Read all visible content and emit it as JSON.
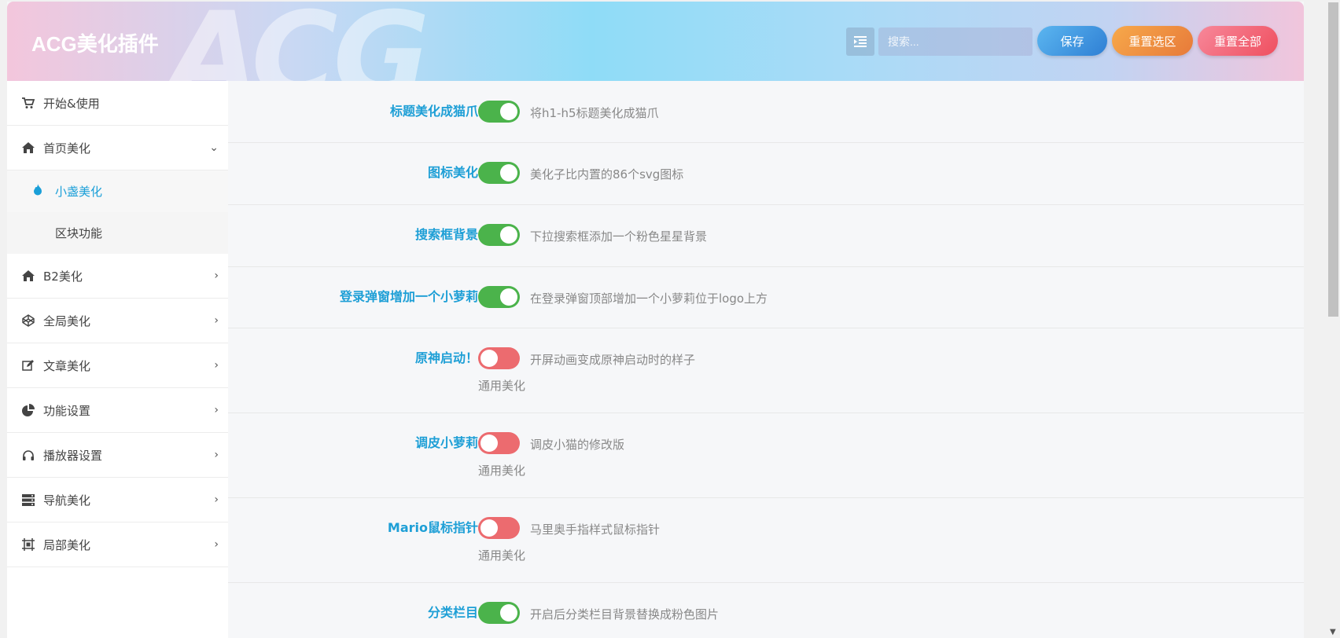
{
  "header": {
    "title": "ACG美化插件",
    "watermark": "ACG",
    "search_placeholder": "搜索...",
    "buttons": {
      "save": "保存",
      "reset_section": "重置选区",
      "reset_all": "重置全部"
    }
  },
  "sidebar": {
    "items": [
      {
        "label": "开始&使用",
        "icon": "cart-icon"
      },
      {
        "label": "首页美化",
        "icon": "home-icon",
        "expanded": true
      },
      {
        "label": "B2美化",
        "icon": "home-icon"
      },
      {
        "label": "全局美化",
        "icon": "codepen-icon"
      },
      {
        "label": "文章美化",
        "icon": "edit-icon"
      },
      {
        "label": "功能设置",
        "icon": "pie-chart-icon"
      },
      {
        "label": "播放器设置",
        "icon": "headphones-icon"
      },
      {
        "label": "导航美化",
        "icon": "server-icon"
      },
      {
        "label": "局部美化",
        "icon": "frame-icon"
      }
    ],
    "subitems": [
      {
        "label": "小盏美化",
        "active": true,
        "icon": "fire-icon"
      },
      {
        "label": "区块功能",
        "active": false
      }
    ]
  },
  "settings": [
    {
      "title": "标题美化成猫爪",
      "enabled": true,
      "desc": "将h1-h5标题美化成猫爪",
      "sub": ""
    },
    {
      "title": "图标美化",
      "enabled": true,
      "desc": "美化子比内置的86个svg图标",
      "sub": ""
    },
    {
      "title": "搜索框背景",
      "enabled": true,
      "desc": "下拉搜索框添加一个粉色星星背景",
      "sub": ""
    },
    {
      "title": "登录弹窗增加一个小萝莉",
      "enabled": true,
      "desc": "在登录弹窗顶部增加一个小萝莉位于logo上方",
      "sub": ""
    },
    {
      "title": "原神启动！",
      "enabled": false,
      "desc": "开屏动画变成原神启动时的样子",
      "sub": "通用美化"
    },
    {
      "title": "调皮小萝莉",
      "enabled": false,
      "desc": "调皮小猫的修改版",
      "sub": "通用美化"
    },
    {
      "title": "Mario鼠标指针",
      "enabled": false,
      "desc": "马里奥手指样式鼠标指针",
      "sub": "通用美化"
    },
    {
      "title": "分类栏目",
      "enabled": true,
      "desc": "开启后分类栏目背景替换成粉色图片",
      "sub": ""
    }
  ],
  "colors": {
    "accent": "#1e9fd6",
    "switch_on": "#4bb34b",
    "switch_off": "#ec6b6f"
  }
}
